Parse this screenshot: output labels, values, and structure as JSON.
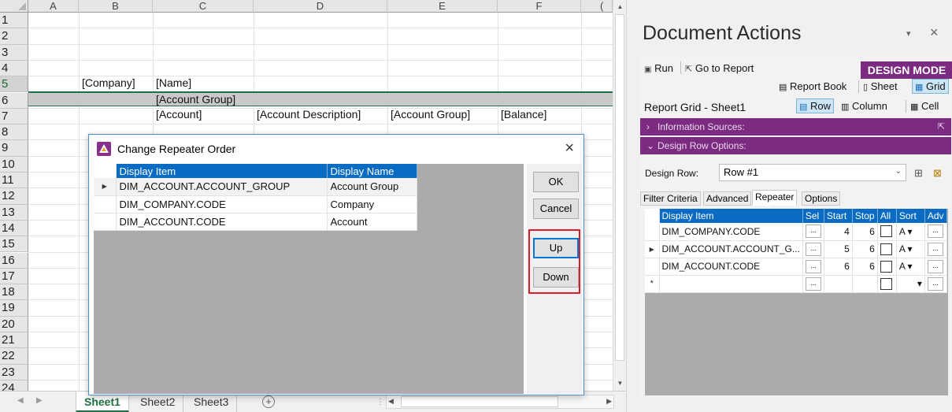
{
  "sheet": {
    "columns": [
      "A",
      "B",
      "C",
      "D",
      "E",
      "F",
      "("
    ],
    "rows": [
      "1",
      "2",
      "3",
      "4",
      "5",
      "6",
      "7",
      "8",
      "9",
      "10",
      "11",
      "12",
      "13",
      "14",
      "15",
      "16",
      "17",
      "18",
      "19",
      "20",
      "21",
      "22",
      "23",
      "24"
    ],
    "cells": {
      "b4": "[Company]",
      "c4": "[Name]",
      "c5": "[Account Group]",
      "c6": "[Account]",
      "d6": "[Account Description]",
      "e6": "[Account Group]",
      "f6": "[Balance]"
    },
    "tabs": [
      "Sheet1",
      "Sheet2",
      "Sheet3"
    ],
    "active_tab": "Sheet1",
    "add_sheet_glyph": "+"
  },
  "dialog": {
    "title": "Change Repeater Order",
    "close_glyph": "×",
    "columns": [
      "Display Item",
      "Display Name"
    ],
    "rows": [
      {
        "item": "DIM_ACCOUNT.ACCOUNT_GROUP",
        "name": "Account Group",
        "current": true
      },
      {
        "item": "DIM_COMPANY.CODE",
        "name": "Company",
        "current": false
      },
      {
        "item": "DIM_ACCOUNT.CODE",
        "name": "Account",
        "current": false
      }
    ],
    "buttons": {
      "ok": "OK",
      "cancel": "Cancel",
      "up": "Up",
      "down": "Down"
    },
    "highlight_color": "#e0192a"
  },
  "pane": {
    "title": "Document Actions",
    "dropdown_glyph": "▾",
    "close_glyph": "×",
    "toolbar": {
      "run": "Run",
      "goto": "Go to Report",
      "design_mode": "DESIGN MODE"
    },
    "toggles": {
      "report_book": "Report Book",
      "sheet": "Sheet",
      "grid": "Grid"
    },
    "grid_title": "Report Grid - Sheet1",
    "grid_toggles": {
      "row": "Row",
      "column": "Column",
      "cell": "Cell"
    },
    "sections": {
      "info": "Information Sources:",
      "design_row_options": "Design Row Options:"
    },
    "design_row": {
      "label": "Design Row:",
      "value": "Row #1"
    },
    "tabs": [
      "Filter Criteria",
      "Advanced",
      "Repeater",
      "Options"
    ],
    "active_tab": "Repeater",
    "grid_columns": [
      "Display Item",
      "Sel",
      "Start",
      "Stop",
      "All",
      "Sort",
      "Adv"
    ],
    "grid_rows": [
      {
        "item": "DIM_COMPANY.CODE",
        "start": "4",
        "stop": "6",
        "sort": "A",
        "current": false
      },
      {
        "item": "DIM_ACCOUNT.ACCOUNT_G...",
        "start": "5",
        "stop": "6",
        "sort": "A",
        "current": true
      },
      {
        "item": "DIM_ACCOUNT.CODE",
        "start": "6",
        "stop": "6",
        "sort": "A",
        "current": false
      }
    ],
    "new_row_marker": "*",
    "accent_color": "#7b2c81",
    "header_color": "#0a6bc2"
  }
}
